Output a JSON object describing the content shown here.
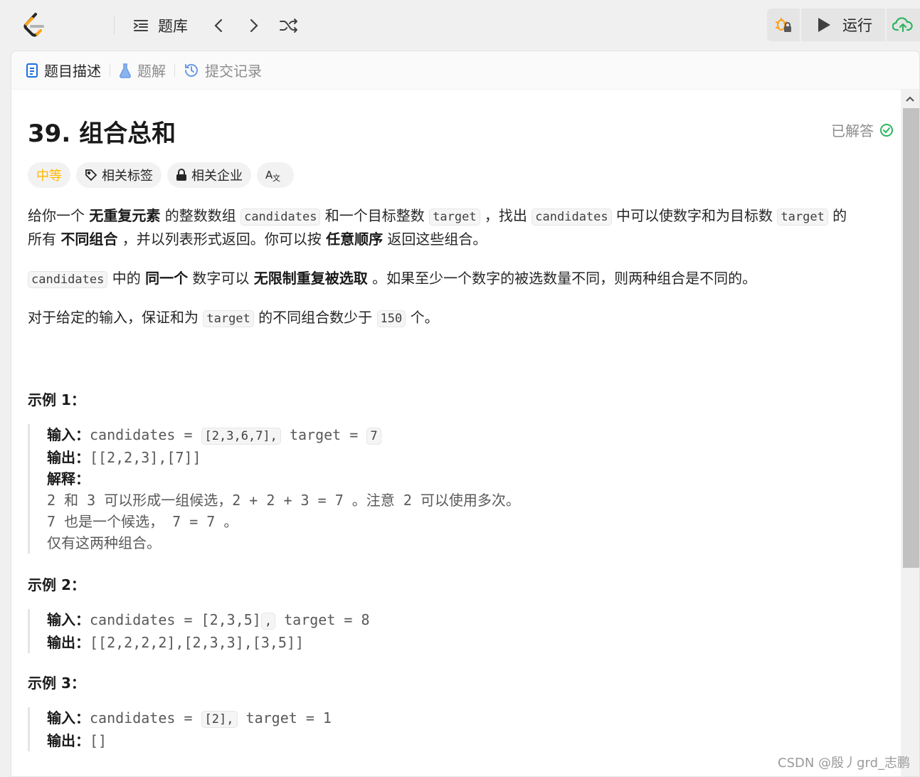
{
  "header": {
    "problemset_label": "题库",
    "run_label": "运行"
  },
  "tabs": [
    {
      "label": "题目描述",
      "icon": "document-icon",
      "active": true
    },
    {
      "label": "题解",
      "icon": "flask-icon",
      "active": false
    },
    {
      "label": "提交记录",
      "icon": "history-icon",
      "active": false
    }
  ],
  "problem": {
    "title": "39. 组合总和",
    "status": "已解答",
    "difficulty": "中等",
    "tags_label": "相关标签",
    "companies_label": "相关企业",
    "translate_label": "A文",
    "desc": {
      "p1": {
        "t1": "给你一个 ",
        "b1": "无重复元素",
        "t2": " 的整数数组 ",
        "c1": "candidates",
        "t3": " 和一个目标整数 ",
        "c2": "target",
        "t4": " ，找出 ",
        "c3": "candidates",
        "t5": " 中可以使数字和为目标数 ",
        "c4": "target",
        "t6": " 的",
        "t7": "所有 ",
        "b2": "不同组合",
        "t8": " ，并以列表形式返回。你可以按 ",
        "b3": "任意顺序",
        "t9": " 返回这些组合。"
      },
      "p2": {
        "c1": "candidates",
        "t1": " 中的 ",
        "b1": "同一个",
        "t2": " 数字可以 ",
        "b2": "无限制重复被选取",
        "t3": " 。如果至少一个数字的被选数量不同，则两种组合是不同的。"
      },
      "p3": {
        "t1": "对于给定的输入，保证和为 ",
        "c1": "target",
        "t2": " 的不同组合数少于 ",
        "c2": "150",
        "t3": " 个。"
      }
    },
    "examples": [
      {
        "title": "示例 1：",
        "input_label": "输入：",
        "input_pre": "candidates = ",
        "input_code": "[2,3,6,7],",
        "input_mid": " target = ",
        "input_code2": "7",
        "output_label": "输出：",
        "output": "[[2,2,3],[7]]",
        "explain_label": "解释：",
        "explain": [
          "2 和 3 可以形成一组候选，2 + 2 + 3 = 7 。注意 2 可以使用多次。",
          "7 也是一个候选， 7 = 7 。",
          "仅有这两种组合。"
        ]
      },
      {
        "title": "示例 2：",
        "input_label": "输入：",
        "input_pre": "candidates = [2,3,5]",
        "input_code": ",",
        "input_mid": " target = 8",
        "output_label": "输出：",
        "output": "[[2,2,2,2],[2,3,3],[3,5]]"
      },
      {
        "title": "示例 3：",
        "input_label": "输入：",
        "input_pre": "candidates = ",
        "input_code": "[2],",
        "input_mid": " target = 1",
        "output_label": "输出：",
        "output": "[]"
      }
    ]
  },
  "watermark": "CSDN @殷丿grd_志鹏",
  "colors": {
    "difficulty_medium": "#ffb800",
    "solved_green": "#2db55d",
    "run_icon": "#404040",
    "submit_green": "#2db55d",
    "logo_orange": "#ffa116"
  }
}
